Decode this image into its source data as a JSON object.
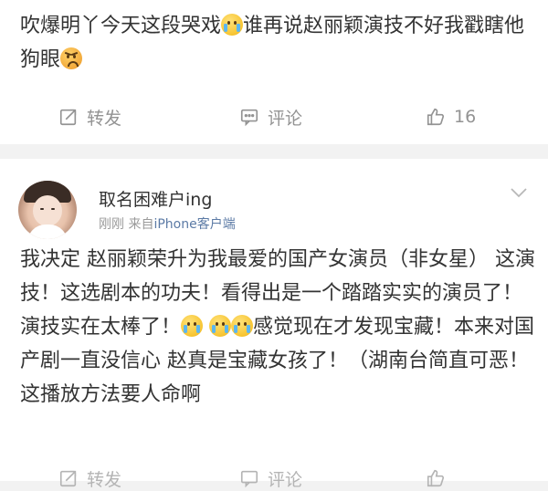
{
  "post_top": {
    "text_part1": "吹爆明丫今天这段哭戏",
    "text_part2": "谁再说赵丽颖演技不好我戳瞎他狗眼",
    "emoji1": "crying-face-emoji",
    "emoji2": "angry-face-emoji",
    "actions": {
      "repost_label": "转发",
      "comment_label": "评论",
      "like_count": "16"
    }
  },
  "post_bottom": {
    "user_name": "取名困难户ing",
    "time": "刚刚",
    "source_prefix": "来自",
    "source": "iPhone客户端",
    "text_part1": "我决定 赵丽颖荣升为我最爱的国产女演员（非女星） 这演技！这选剧本的功夫！看得出是一个踏踏实实的演员了！演技实在太棒了！",
    "text_part2": "感觉现在才发现宝藏！本来对国产剧一直没信心 赵真是宝藏女孩了！（湖南台简直可恶！这播放方法要人命啊",
    "actions": {
      "repost_label": "转发",
      "comment_label": "评论",
      "like_count": ""
    }
  },
  "colors": {
    "text": "#333333",
    "muted": "#939393",
    "link": "#5b7aa5",
    "background": "#f2f2f2"
  }
}
